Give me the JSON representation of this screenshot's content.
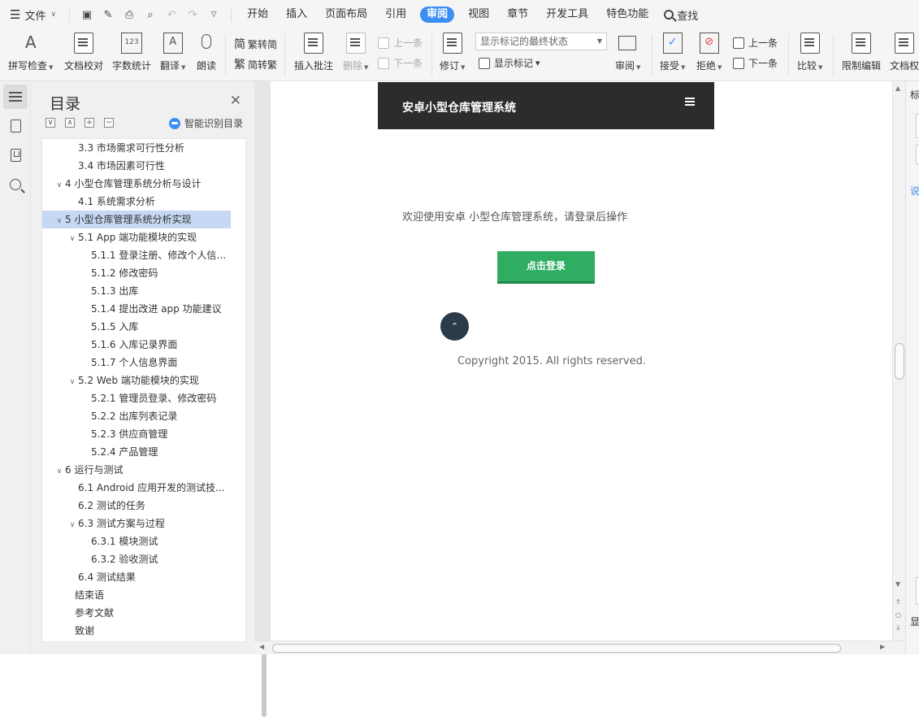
{
  "menubar": {
    "file_label": "文件",
    "tabs": [
      "开始",
      "插入",
      "页面布局",
      "引用",
      "审阅",
      "视图",
      "章节",
      "开发工具",
      "特色功能"
    ],
    "active_tab": "审阅",
    "find_label": "查找"
  },
  "ribbon": {
    "spell_check": "拼写检查",
    "doc_proof": "文档校对",
    "word_count": "字数统计",
    "translate": "翻译",
    "read_aloud": "朗读",
    "trad_to_simp": "繁转简",
    "simp_to_trad": "简转繁",
    "insert_comment": "插入批注",
    "delete": "删除",
    "prev_comment": "上一条",
    "next_comment": "下一条",
    "track_changes": "修订",
    "markup_state": "显示标记的最终状态",
    "show_markup": "显示标记",
    "review_pane": "审阅",
    "accept": "接受",
    "reject": "拒绝",
    "prev_change": "上一条",
    "next_change": "下一条",
    "compare": "比较",
    "restrict_edit": "限制编辑",
    "doc_rights": "文档权"
  },
  "toc": {
    "title": "目录",
    "smart_label": "智能识别目录",
    "items": [
      {
        "text": "3.3 市场需求可行性分析",
        "level": 2,
        "arrow": ""
      },
      {
        "text": "3.4  市场因素可行性",
        "level": 2,
        "arrow": ""
      },
      {
        "text": "4  小型仓库管理系统分析与设计",
        "level": 1,
        "arrow": "∨"
      },
      {
        "text": "4.1  系统需求分析",
        "level": 2,
        "arrow": ""
      },
      {
        "text": "5  小型仓库管理系统分析实现",
        "level": 1,
        "arrow": "∨",
        "selected": true
      },
      {
        "text": "5.1 App 端功能模块的实现",
        "level": 2,
        "arrow": "∨"
      },
      {
        "text": "5.1.1  登录注册、修改个人信息...",
        "level": 3,
        "arrow": ""
      },
      {
        "text": "5.1.2 修改密码",
        "level": 3,
        "arrow": ""
      },
      {
        "text": "5.1.3 出库",
        "level": 3,
        "arrow": ""
      },
      {
        "text": "5.1.4 提出改进 app 功能建议",
        "level": 3,
        "arrow": ""
      },
      {
        "text": "5.1.5 入库",
        "level": 3,
        "arrow": ""
      },
      {
        "text": "5.1.6 入库记录界面",
        "level": 3,
        "arrow": ""
      },
      {
        "text": "5.1.7 个人信息界面",
        "level": 3,
        "arrow": ""
      },
      {
        "text": "5.2 Web 端功能模块的实现",
        "level": 2,
        "arrow": "∨"
      },
      {
        "text": "5.2.1 管理员登录、修改密码",
        "level": 3,
        "arrow": ""
      },
      {
        "text": "5.2.2  出库列表记录",
        "level": 3,
        "arrow": ""
      },
      {
        "text": "5.2.3  供应商管理",
        "level": 3,
        "arrow": ""
      },
      {
        "text": "5.2.4 产品管理",
        "level": 3,
        "arrow": ""
      },
      {
        "text": "6  运行与测试",
        "level": 1,
        "arrow": "∨"
      },
      {
        "text": "6.1 Android 应用开发的测试技...",
        "level": 2,
        "arrow": ""
      },
      {
        "text": "6.2  测试的任务",
        "level": 2,
        "arrow": ""
      },
      {
        "text": "6.3  测试方案与过程",
        "level": 2,
        "arrow": "∨"
      },
      {
        "text": "6.3.1  模块测试",
        "level": 3,
        "arrow": ""
      },
      {
        "text": "6.3.2  验收测试",
        "level": 3,
        "arrow": ""
      },
      {
        "text": "6.4  测试结果",
        "level": 2,
        "arrow": ""
      },
      {
        "text": "结束语",
        "level": 0,
        "arrow": ""
      },
      {
        "text": "参考文献",
        "level": 0,
        "arrow": ""
      },
      {
        "text": "致谢",
        "level": 0,
        "arrow": ""
      }
    ]
  },
  "document": {
    "app_title": "安卓小型仓库管理系统",
    "welcome": "欢迎使用安卓 小型仓库管理系统，请登录后操作",
    "login_button": "点击登录",
    "copyright": "Copyright 2015. All rights reserved."
  },
  "right_panel": {
    "chars": [
      "标",
      "说",
      "显"
    ]
  },
  "colors": {
    "accent": "#3d8ef2",
    "login_green": "#2fae63",
    "appbar": "#2c2c2c"
  }
}
